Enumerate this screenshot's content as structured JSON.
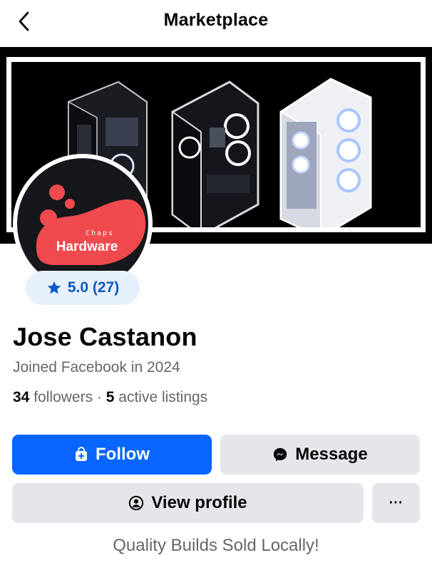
{
  "header": {
    "title": "Marketplace",
    "back_icon": "chevron-left-icon"
  },
  "profile": {
    "logo_text": "Hardware",
    "logo_small": "Chaps",
    "rating": "5.0 (27)",
    "name": "Jose Castanon",
    "joined": "Joined Facebook in 2024",
    "followers_count": "34",
    "followers_label": "followers",
    "separator": "·",
    "listings_count": "5",
    "listings_label": "active listings",
    "tagline": "Quality Builds Sold Locally!"
  },
  "actions": {
    "follow_label": "Follow",
    "message_label": "Message",
    "view_profile_label": "View profile",
    "more_label": "···"
  },
  "colors": {
    "primary": "#0866ff",
    "secondary_button": "#e4e6eb",
    "rating_bg": "#e7f0fd",
    "rating_text": "#0a58c2",
    "logo_accent": "#ef4a4d",
    "muted_text": "#65676b"
  }
}
